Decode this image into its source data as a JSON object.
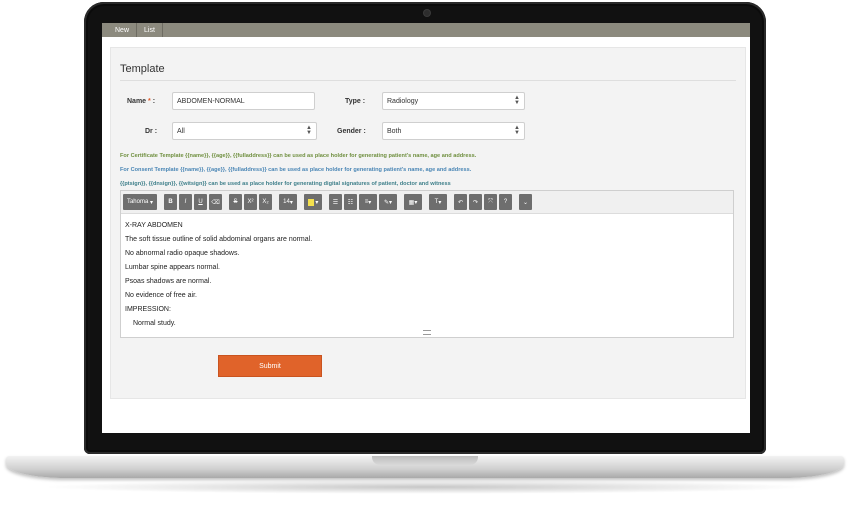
{
  "nav": {
    "tabs": [
      "New",
      "List"
    ]
  },
  "page": {
    "title": "Template"
  },
  "form": {
    "name_label": "Name",
    "required_mark": "*",
    "colon": ":",
    "name_value": "ABDOMEN-NORMAL",
    "type_label": "Type",
    "type_value": "Radiology",
    "dr_label": "Dr",
    "dr_value": "All",
    "gender_label": "Gender",
    "gender_value": "Both"
  },
  "hints": [
    "For Certificate Template {{name}}, {{age}}, {{fulladdress}} can be used as place holder for generating patient's name, age and address.",
    "For Consent Template {{name}}, {{age}}, {{fulladdress}} can be used as place holder for generating patient's name, age and address.",
    "{{ptsign}}, {{dnsign}}, {{witsign}} can be used as place holder for generating digital signatures of patient, doctor and witness"
  ],
  "toolbar": {
    "font": "Tahoma",
    "bold": "B",
    "italic": "I",
    "underline": "U",
    "eraser": "⌫",
    "strike": "S",
    "superscript": "X²",
    "subscript": "X₂",
    "fontsize": "14",
    "bullets": "☰",
    "numbered": "☷",
    "align": "≡",
    "magic": "✎",
    "table": "▦",
    "textstyle": "T",
    "undo": "↶",
    "redo": "↷",
    "fullscreen": "⤧",
    "help": "?",
    "collapse": "⌄"
  },
  "editor": {
    "lines": [
      "X-RAY ABDOMEN",
      "The soft tissue outline of solid abdominal organs are normal.",
      "No abnormal radio opaque shadows.",
      "Lumbar spine appears normal.",
      "Psoas shadows are normal.",
      "No evidence of free air.",
      "IMPRESSION:",
      "Normal study."
    ]
  },
  "actions": {
    "submit": "Submit"
  },
  "colors": {
    "accent": "#e0632a",
    "topbar": "#8c8a7e",
    "hint_green": "#6f8f3f",
    "hint_blue": "#4a86b5"
  }
}
